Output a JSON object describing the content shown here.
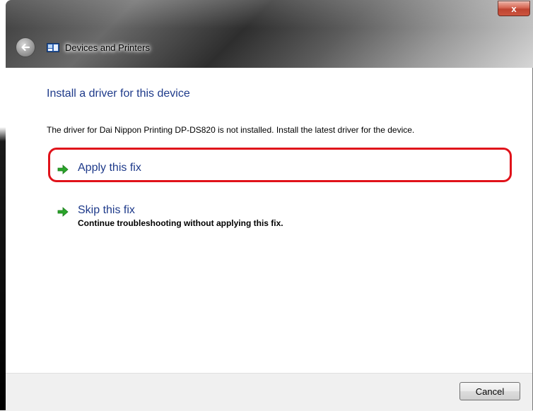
{
  "window": {
    "title": "Devices and Printers",
    "close_label": "x"
  },
  "main": {
    "heading": "Install a driver for this device",
    "description": "The driver for Dai Nippon Printing DP-DS820 is not installed. Install the latest driver for the device.",
    "options": [
      {
        "label": "Apply this fix",
        "icon": "green-arrow-icon",
        "highlighted": true
      },
      {
        "label": "Skip this fix",
        "sublabel": "Continue troubleshooting without applying this fix.",
        "icon": "green-arrow-icon"
      }
    ]
  },
  "footer": {
    "cancel_label": "Cancel"
  },
  "colors": {
    "heading": "#1e3a8a",
    "highlight": "#e0121a",
    "arrow": "#2aa52a"
  }
}
